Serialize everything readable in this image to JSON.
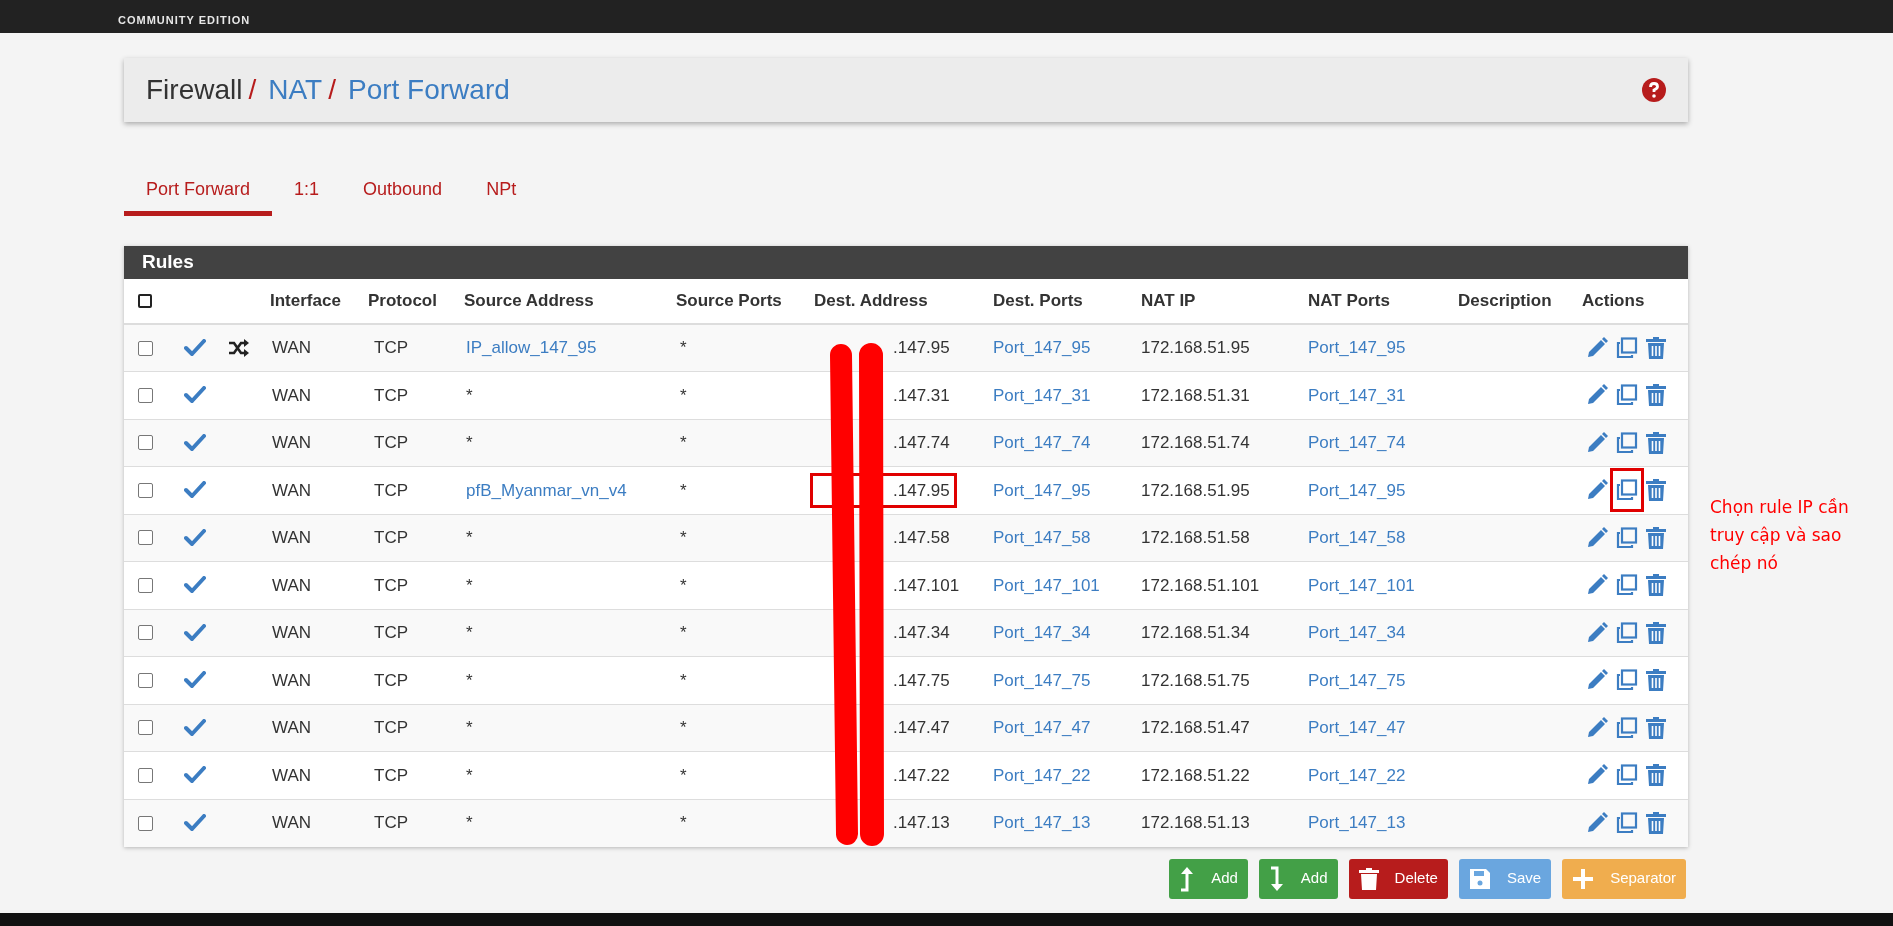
{
  "header": {
    "edition": "COMMUNITY EDITION"
  },
  "breadcrumb": [
    {
      "text": "Firewall",
      "kind": "plain"
    },
    {
      "text": "/",
      "kind": "separator"
    },
    {
      "text": "NAT",
      "kind": "link"
    },
    {
      "text": "/",
      "kind": "separator"
    },
    {
      "text": "Port Forward",
      "kind": "link"
    }
  ],
  "tabs": [
    {
      "label": "Port Forward",
      "selected": true
    },
    {
      "label": "1:1",
      "selected": false
    },
    {
      "label": "Outbound",
      "selected": false
    },
    {
      "label": "NPt",
      "selected": false
    }
  ],
  "rules": {
    "title": "Rules",
    "select_all": {
      "checked": false
    },
    "columns": [
      "Interface",
      "Protocol",
      "Source Address",
      "Source Ports",
      "Dest. Address",
      "Dest. Ports",
      "NAT IP",
      "NAT Ports",
      "Description",
      "Actions"
    ],
    "rows": [
      {
        "checked": false,
        "enabled": true,
        "linked": true,
        "highlighted": false,
        "interface": "WAN",
        "protocol": "TCP",
        "source": "IP_allow_147_95",
        "source_ports": "*",
        "dest": ".147.95",
        "dest_ports": "Port_147_95",
        "nat_ip": "172.168.51.95",
        "nat_ports": "Port_147_95"
      },
      {
        "checked": false,
        "enabled": true,
        "linked": false,
        "highlighted": false,
        "interface": "WAN",
        "protocol": "TCP",
        "source": "*",
        "source_ports": "*",
        "dest": ".147.31",
        "dest_ports": "Port_147_31",
        "nat_ip": "172.168.51.31",
        "nat_ports": "Port_147_31"
      },
      {
        "checked": false,
        "enabled": true,
        "linked": false,
        "highlighted": false,
        "interface": "WAN",
        "protocol": "TCP",
        "source": "*",
        "source_ports": "*",
        "dest": ".147.74",
        "dest_ports": "Port_147_74",
        "nat_ip": "172.168.51.74",
        "nat_ports": "Port_147_74"
      },
      {
        "checked": false,
        "enabled": true,
        "linked": false,
        "highlighted": true,
        "interface": "WAN",
        "protocol": "TCP",
        "source": "pfB_Myanmar_vn_v4",
        "source_ports": "*",
        "dest": ".147.95",
        "dest_ports": "Port_147_95",
        "nat_ip": "172.168.51.95",
        "nat_ports": "Port_147_95"
      },
      {
        "checked": false,
        "enabled": true,
        "linked": false,
        "highlighted": false,
        "interface": "WAN",
        "protocol": "TCP",
        "source": "*",
        "source_ports": "*",
        "dest": ".147.58",
        "dest_ports": "Port_147_58",
        "nat_ip": "172.168.51.58",
        "nat_ports": "Port_147_58"
      },
      {
        "checked": false,
        "enabled": true,
        "linked": false,
        "highlighted": false,
        "interface": "WAN",
        "protocol": "TCP",
        "source": "*",
        "source_ports": "*",
        "dest": ".147.101",
        "dest_ports": "Port_147_101",
        "nat_ip": "172.168.51.101",
        "nat_ports": "Port_147_101"
      },
      {
        "checked": false,
        "enabled": true,
        "linked": false,
        "highlighted": false,
        "interface": "WAN",
        "protocol": "TCP",
        "source": "*",
        "source_ports": "*",
        "dest": ".147.34",
        "dest_ports": "Port_147_34",
        "nat_ip": "172.168.51.34",
        "nat_ports": "Port_147_34"
      },
      {
        "checked": false,
        "enabled": true,
        "linked": false,
        "highlighted": false,
        "interface": "WAN",
        "protocol": "TCP",
        "source": "*",
        "source_ports": "*",
        "dest": ".147.75",
        "dest_ports": "Port_147_75",
        "nat_ip": "172.168.51.75",
        "nat_ports": "Port_147_75"
      },
      {
        "checked": false,
        "enabled": true,
        "linked": false,
        "highlighted": false,
        "interface": "WAN",
        "protocol": "TCP",
        "source": "*",
        "source_ports": "*",
        "dest": ".147.47",
        "dest_ports": "Port_147_47",
        "nat_ip": "172.168.51.47",
        "nat_ports": "Port_147_47"
      },
      {
        "checked": false,
        "enabled": true,
        "linked": false,
        "highlighted": false,
        "interface": "WAN",
        "protocol": "TCP",
        "source": "*",
        "source_ports": "*",
        "dest": ".147.22",
        "dest_ports": "Port_147_22",
        "nat_ip": "172.168.51.22",
        "nat_ports": "Port_147_22"
      },
      {
        "checked": false,
        "enabled": true,
        "linked": false,
        "highlighted": false,
        "interface": "WAN",
        "protocol": "TCP",
        "source": "*",
        "source_ports": "*",
        "dest": ".147.13",
        "dest_ports": "Port_147_13",
        "nat_ip": "172.168.51.13",
        "nat_ports": "Port_147_13"
      }
    ]
  },
  "buttons": [
    {
      "label": "Add",
      "kind": "add_above"
    },
    {
      "label": "Add",
      "kind": "add_below"
    },
    {
      "label": "Delete",
      "kind": "delete"
    },
    {
      "label": "Save",
      "kind": "save"
    },
    {
      "label": "Separator",
      "kind": "separator"
    }
  ],
  "note": "Chọn rule IP cần truy cập và sao chép nó"
}
